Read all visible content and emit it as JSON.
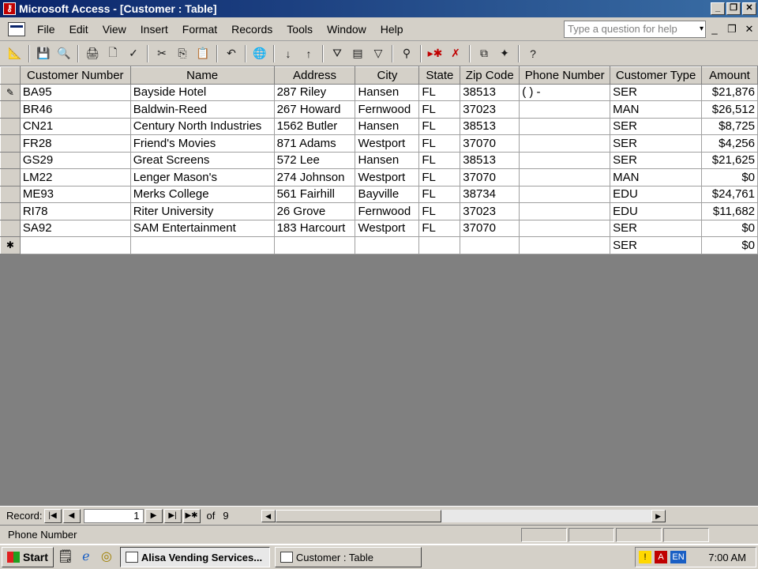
{
  "window": {
    "title": "Microsoft Access - [Customer : Table]",
    "app_icon": "access-key-icon"
  },
  "menu": {
    "items": [
      "File",
      "Edit",
      "View",
      "Insert",
      "Format",
      "Records",
      "Tools",
      "Window",
      "Help"
    ],
    "help_placeholder": "Type a question for help"
  },
  "toolbar": {
    "icons": [
      "design-view-icon",
      "save-icon",
      "search-file-icon",
      "print-icon",
      "print-preview-icon",
      "spelling-icon",
      "cut-icon",
      "copy-icon",
      "paste-icon",
      "undo-icon",
      "hyperlink-icon",
      "sort-ascending-icon",
      "sort-descending-icon",
      "filter-by-selection-icon",
      "filter-by-form-icon",
      "apply-filter-icon",
      "find-icon",
      "new-record-icon",
      "delete-record-icon",
      "database-window-icon",
      "new-object-icon",
      "help-icon"
    ]
  },
  "table": {
    "columns": [
      "Customer Number",
      "Name",
      "Address",
      "City",
      "State",
      "Zip Code",
      "Phone Number",
      "Customer Type",
      "Amount"
    ],
    "rows": [
      [
        "BA95",
        "Bayside Hotel",
        "287 Riley",
        "Hansen",
        "FL",
        "38513",
        "(   )   -",
        "SER",
        "$21,876"
      ],
      [
        "BR46",
        "Baldwin-Reed",
        "267 Howard",
        "Fernwood",
        "FL",
        "37023",
        "",
        "MAN",
        "$26,512"
      ],
      [
        "CN21",
        "Century North Industries",
        "1562 Butler",
        "Hansen",
        "FL",
        "38513",
        "",
        "SER",
        "$8,725"
      ],
      [
        "FR28",
        "Friend's Movies",
        "871 Adams",
        "Westport",
        "FL",
        "37070",
        "",
        "SER",
        "$4,256"
      ],
      [
        "GS29",
        "Great Screens",
        "572 Lee",
        "Hansen",
        "FL",
        "38513",
        "",
        "SER",
        "$21,625"
      ],
      [
        "LM22",
        "Lenger Mason's",
        "274 Johnson",
        "Westport",
        "FL",
        "37070",
        "",
        "MAN",
        "$0"
      ],
      [
        "ME93",
        "Merks College",
        "561 Fairhill",
        "Bayville",
        "FL",
        "38734",
        "",
        "EDU",
        "$24,761"
      ],
      [
        "RI78",
        "Riter University",
        "26 Grove",
        "Fernwood",
        "FL",
        "37023",
        "",
        "EDU",
        "$11,682"
      ],
      [
        "SA92",
        "SAM Entertainment",
        "183 Harcourt",
        "Westport",
        "FL",
        "37070",
        "",
        "SER",
        "$0"
      ],
      [
        "",
        "",
        "",
        "",
        "",
        "",
        "",
        "SER",
        "$0"
      ]
    ],
    "selectors": [
      "✎",
      "",
      "",
      "",
      "",
      "",
      "",
      "",
      "",
      "✱"
    ]
  },
  "navigation": {
    "record_label": "Record:",
    "current": "1",
    "of_label": "of",
    "total": "9"
  },
  "status": {
    "text": "Phone Number"
  },
  "taskbar": {
    "start": "Start",
    "tasks": [
      "Alisa Vending Services...",
      "Customer : Table"
    ],
    "clock": "7:00 AM",
    "lang": "EN"
  }
}
